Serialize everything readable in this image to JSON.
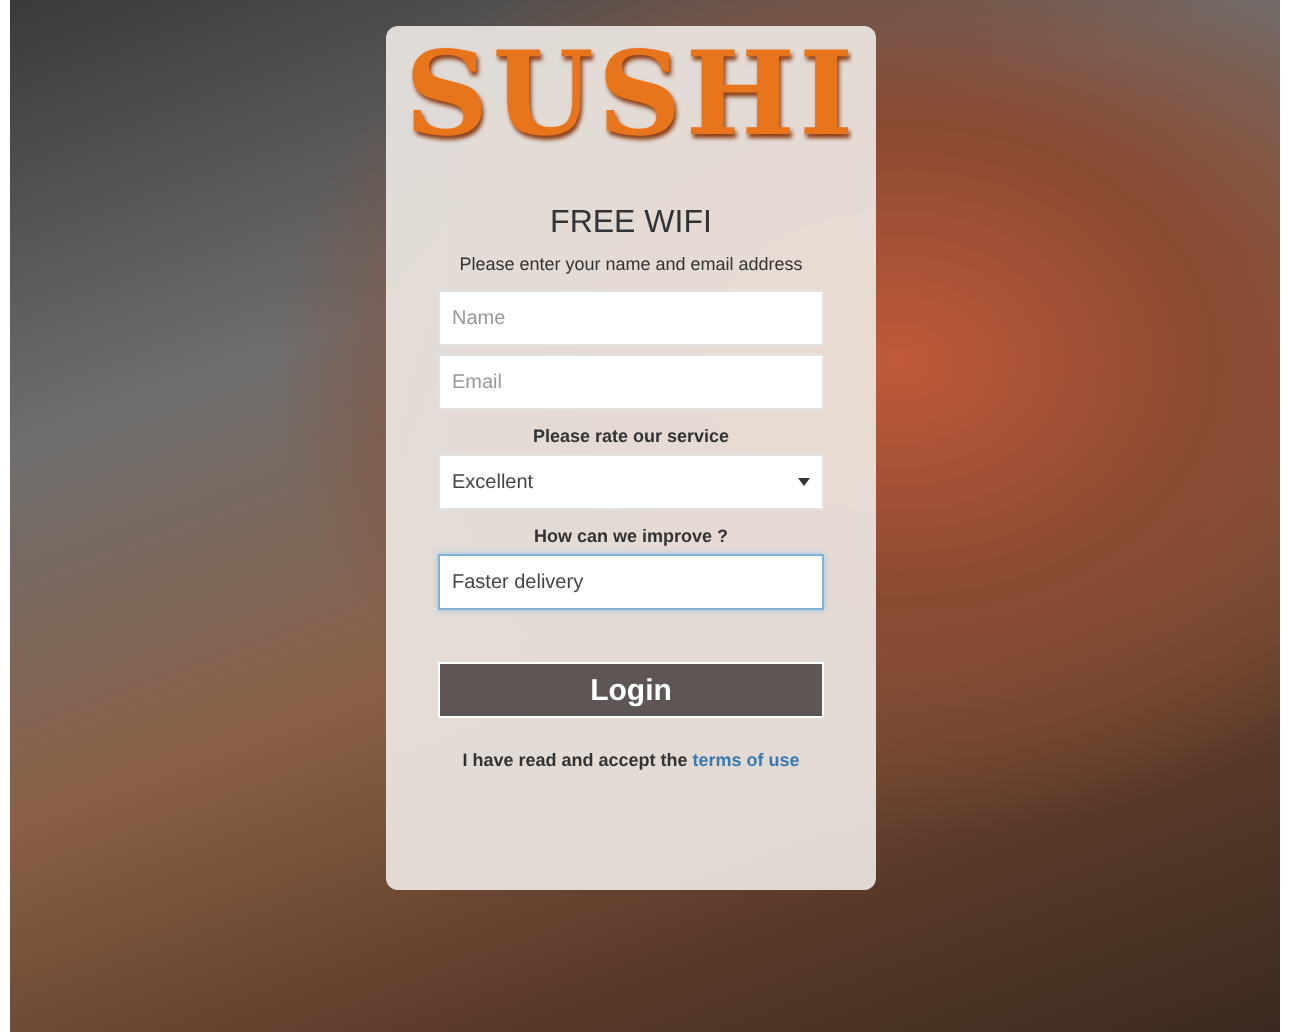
{
  "logo": {
    "text": "SUSHI"
  },
  "form": {
    "title": "FREE WIFI",
    "instructions": "Please enter your name and email address",
    "fields": [
      {
        "kind": "text",
        "placeholder": "Name",
        "focused": false
      },
      {
        "kind": "text",
        "placeholder": "Email",
        "focused": false
      },
      {
        "kind": "label",
        "text": "Please rate our service"
      },
      {
        "kind": "select",
        "value": "Excellent",
        "focused": false
      },
      {
        "kind": "label",
        "text": "How can we improve ?"
      },
      {
        "kind": "text",
        "value": "Faster delivery",
        "focused": true
      }
    ],
    "login_button": "Login",
    "terms": {
      "text": "I have read and accept the",
      "link": "terms of use"
    }
  }
}
